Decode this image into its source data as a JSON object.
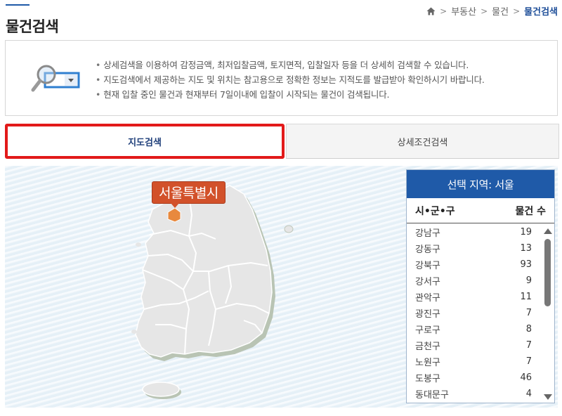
{
  "page": {
    "title": "물건검색"
  },
  "breadcrumb": {
    "items": [
      "부동산",
      "물건"
    ],
    "current": "물건검색",
    "separator": ">"
  },
  "notice": {
    "lines": [
      "상세검색을 이용하여 감정금액, 최저입찰금액, 토지면적, 입찰일자 등을 더 상세히 검색할 수 있습니다.",
      "지도검색에서 제공하는 지도 및 위치는 참고용으로 정확한 정보는 지적도를 발급받아 확인하시기 바랍니다.",
      "현재 입찰 중인 물건과 현재부터 7일이내에 입찰이 시작되는 물건이 검색됩니다."
    ]
  },
  "tabs": {
    "map_search": "지도검색",
    "detail_search": "상세조건검색"
  },
  "map": {
    "selected_region_label": "서울특별시",
    "highlight_color": "#e8893e"
  },
  "panel": {
    "title": "선택 지역: 서울",
    "col_district": "시•군•구",
    "col_count": "물건 수",
    "rows": [
      {
        "name": "강남구",
        "count": "19"
      },
      {
        "name": "강동구",
        "count": "13"
      },
      {
        "name": "강북구",
        "count": "93"
      },
      {
        "name": "강서구",
        "count": "9"
      },
      {
        "name": "관악구",
        "count": "11"
      },
      {
        "name": "광진구",
        "count": "7"
      },
      {
        "name": "구로구",
        "count": "8"
      },
      {
        "name": "금천구",
        "count": "7"
      },
      {
        "name": "노원구",
        "count": "7"
      },
      {
        "name": "도봉구",
        "count": "46"
      },
      {
        "name": "동대문구",
        "count": "4"
      }
    ]
  },
  "colors": {
    "accent": "#1f5aa8",
    "active_tab_border": "#e21a1a",
    "label_bg": "#d2512a"
  },
  "icons": {
    "home": "home-icon",
    "search_illustration": "magnifier-dropdown-icon",
    "scroll_up": "scroll-up-icon",
    "scroll_down": "scroll-down-icon"
  }
}
